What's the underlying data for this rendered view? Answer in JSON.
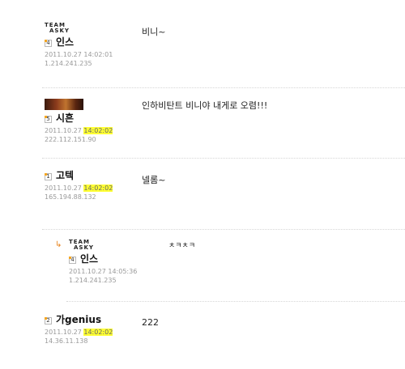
{
  "comments": [
    {
      "avatar": "TEAM ASKY logo",
      "logo_line1": "TEAM",
      "logo_line2": "ASKY",
      "level": "4",
      "name": "인스",
      "date": "2011.10.27",
      "time": "14:02:01",
      "ip": "1.214.241.235",
      "text": "비니~"
    },
    {
      "avatar": "profile-photo",
      "level": "5",
      "name": "시흔",
      "date": "2011.10.27",
      "time": "14:02:02",
      "ip": "222.112.151.90",
      "text": "인하비탄트 비니야 내게로 오렴!!!"
    },
    {
      "level": "1",
      "name": "고텍",
      "date": "2011.10.27",
      "time": "14:02:02",
      "ip": "165.194.88.132",
      "text": "넬롬~"
    },
    {
      "reply": true,
      "avatar": "TEAM ASKY logo",
      "logo_line1": "TEAM",
      "logo_line2": "ASKY",
      "level": "4",
      "name": "인스",
      "date": "2011.10.27",
      "time": "14:05:36",
      "ip": "1.214.241.235",
      "text": "ㅊㅋㅊㅋ"
    },
    {
      "level": "2",
      "name": "가genius",
      "date": "2011.10.27",
      "time": "14:02:02",
      "ip": "14.36.11.138",
      "text": "222"
    }
  ],
  "colors": {
    "highlight": "#ffff33",
    "meta_text": "#9a9a9a",
    "reply_arrow": "#e8841e"
  },
  "icons": {
    "reply": "reply-arrow-icon",
    "level": "level-badge-icon"
  }
}
